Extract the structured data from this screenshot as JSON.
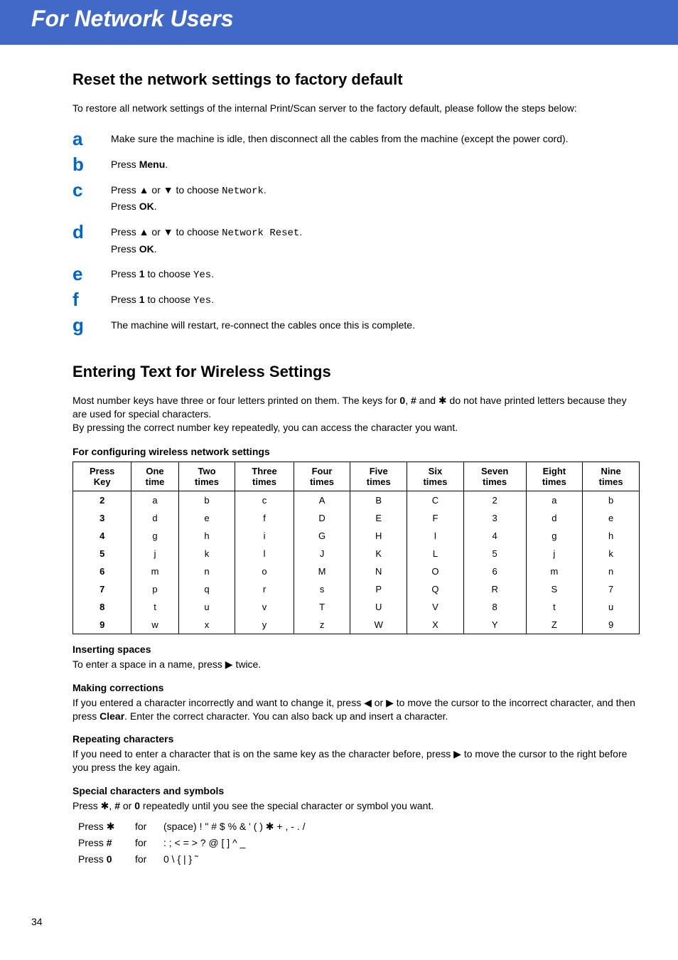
{
  "banner": {
    "title": "For Network Users"
  },
  "reset": {
    "heading": "Reset the network settings to factory default",
    "intro": "To restore all network settings of the internal Print/Scan server to the factory default, please follow the steps below:",
    "steps": {
      "a": "Make sure the machine is idle, then disconnect all the cables from the machine (except the power cord).",
      "b_pre": "Press ",
      "b_bold": "Menu",
      "b_post": ".",
      "c_l1_pre": "Press ▲ or ▼ to choose ",
      "c_l1_code": "Network",
      "c_l1_post": ".",
      "c_l2_pre": "Press ",
      "c_l2_bold": "OK",
      "c_l2_post": ".",
      "d_l1_pre": "Press ▲ or ▼ to choose ",
      "d_l1_code": "Network Reset",
      "d_l1_post": ".",
      "d_l2_pre": "Press ",
      "d_l2_bold": "OK",
      "d_l2_post": ".",
      "e_pre": "Press ",
      "e_bold": "1",
      "e_mid": " to choose ",
      "e_code": "Yes",
      "e_post": ".",
      "f_pre": "Press ",
      "f_bold": "1",
      "f_mid": " to choose ",
      "f_code": "Yes",
      "f_post": ".",
      "g": "The machine will restart, re-connect the cables once this is complete."
    }
  },
  "entering": {
    "heading": "Entering Text for Wireless Settings",
    "para_a": "Most number keys have three or four letters printed on them. The keys for ",
    "para_b0": "0",
    "para_b1": ", ",
    "para_b2": "#",
    "para_b3": " and ✱ do not have printed letters because they are used for special characters.",
    "para_c": "By pressing the correct number key repeatedly, you can access the character you want.",
    "table_caption": "For configuring wireless network settings"
  },
  "chart_data": {
    "type": "table",
    "title": "For configuring wireless network settings",
    "columns": [
      "Press Key",
      "One time",
      "Two times",
      "Three times",
      "Four times",
      "Five times",
      "Six times",
      "Seven times",
      "Eight times",
      "Nine times"
    ],
    "rows": [
      [
        "2",
        "a",
        "b",
        "c",
        "A",
        "B",
        "C",
        "2",
        "a",
        "b"
      ],
      [
        "3",
        "d",
        "e",
        "f",
        "D",
        "E",
        "F",
        "3",
        "d",
        "e"
      ],
      [
        "4",
        "g",
        "h",
        "i",
        "G",
        "H",
        "I",
        "4",
        "g",
        "h"
      ],
      [
        "5",
        "j",
        "k",
        "l",
        "J",
        "K",
        "L",
        "5",
        "j",
        "k"
      ],
      [
        "6",
        "m",
        "n",
        "o",
        "M",
        "N",
        "O",
        "6",
        "m",
        "n"
      ],
      [
        "7",
        "p",
        "q",
        "r",
        "s",
        "P",
        "Q",
        "R",
        "S",
        "7"
      ],
      [
        "8",
        "t",
        "u",
        "v",
        "T",
        "U",
        "V",
        "8",
        "t",
        "u"
      ],
      [
        "9",
        "w",
        "x",
        "y",
        "z",
        "W",
        "X",
        "Y",
        "Z",
        "9"
      ]
    ]
  },
  "inserting": {
    "heading": "Inserting spaces",
    "text": "To enter a space in a name, press ▶ twice."
  },
  "making": {
    "heading": "Making corrections",
    "text_a": "If you entered a character incorrectly and want to change it, press ◀ or ▶ to move the cursor to the incorrect character, and then press ",
    "text_bold": "Clear",
    "text_b": ". Enter the correct character. You can also back up and insert a character."
  },
  "repeating": {
    "heading": "Repeating characters",
    "text": "If you need to enter a character that is on the same key as the character before, press ▶ to move the cursor to the right before you press the key again."
  },
  "special": {
    "heading": "Special characters and symbols",
    "intro_a": "Press ✱, ",
    "intro_b": "#",
    "intro_c": " or ",
    "intro_d": "0",
    "intro_e": " repeatedly until you see the special character or symbol you want.",
    "rows": [
      {
        "key_pre": "Press ",
        "key": "✱",
        "for": "for",
        "chars": "(space) ! \" # $ % & ' ( ) ✱ + , - . /"
      },
      {
        "key_pre": "Press ",
        "key": "#",
        "for": "for",
        "chars": ": ; < = > ? @ [ ] ^ _"
      },
      {
        "key_pre": "Press ",
        "key": "0",
        "for": "for",
        "chars": "0 \\ { | } ˜"
      }
    ]
  },
  "page_number": "34"
}
